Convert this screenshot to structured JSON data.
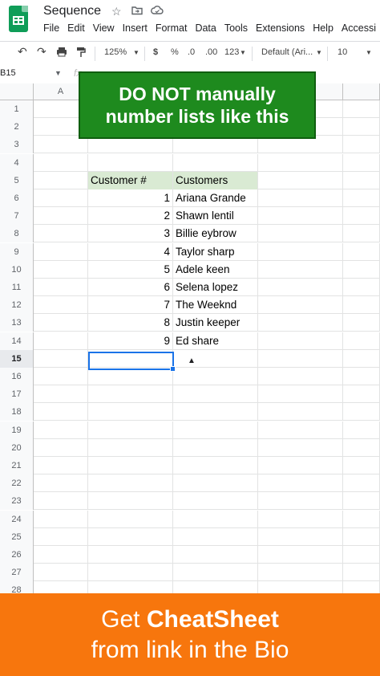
{
  "app": {
    "doc_title": "Sequence",
    "menu": [
      "File",
      "Edit",
      "View",
      "Insert",
      "Format",
      "Data",
      "Tools",
      "Extensions",
      "Help",
      "Accessi"
    ]
  },
  "toolbar": {
    "zoom": "125%",
    "currency": "$",
    "percent": "%",
    "dec_decrease": ".0",
    "dec_increase": ".00",
    "more_formats": "123",
    "font": "Default (Ari...",
    "font_size": "10"
  },
  "namebox": {
    "ref": "B15",
    "fx": "fx"
  },
  "sheet": {
    "columns": [
      "A"
    ],
    "row_numbers": [
      "1",
      "2",
      "3",
      "4",
      "5",
      "6",
      "7",
      "8",
      "9",
      "10",
      "11",
      "12",
      "13",
      "14",
      "15",
      "16",
      "17",
      "18",
      "19",
      "20",
      "21",
      "22",
      "23",
      "24",
      "25",
      "26",
      "27",
      "28"
    ],
    "header": {
      "num": "Customer #",
      "name": "Customers"
    },
    "rows": [
      {
        "num": "1",
        "name": "Ariana Grande"
      },
      {
        "num": "2",
        "name": "Shawn lentil"
      },
      {
        "num": "3",
        "name": "Billie eybrow"
      },
      {
        "num": "4",
        "name": "Taylor sharp"
      },
      {
        "num": "5",
        "name": "Adele keen"
      },
      {
        "num": "6",
        "name": "Selena lopez"
      },
      {
        "num": "7",
        "name": "The Weeknd"
      },
      {
        "num": "8",
        "name": "Justin keeper"
      },
      {
        "num": "9",
        "name": "Ed share"
      }
    ],
    "header_color": "#d9ead3",
    "selected_row": "15"
  },
  "banner": {
    "line1": "DO NOT manually",
    "line2": "number lists like this",
    "color": "#1e8a1e"
  },
  "footer": {
    "pre": "Get ",
    "bold": "CheatSheet",
    "line2": "from link in the Bio",
    "color": "#f7760d"
  }
}
